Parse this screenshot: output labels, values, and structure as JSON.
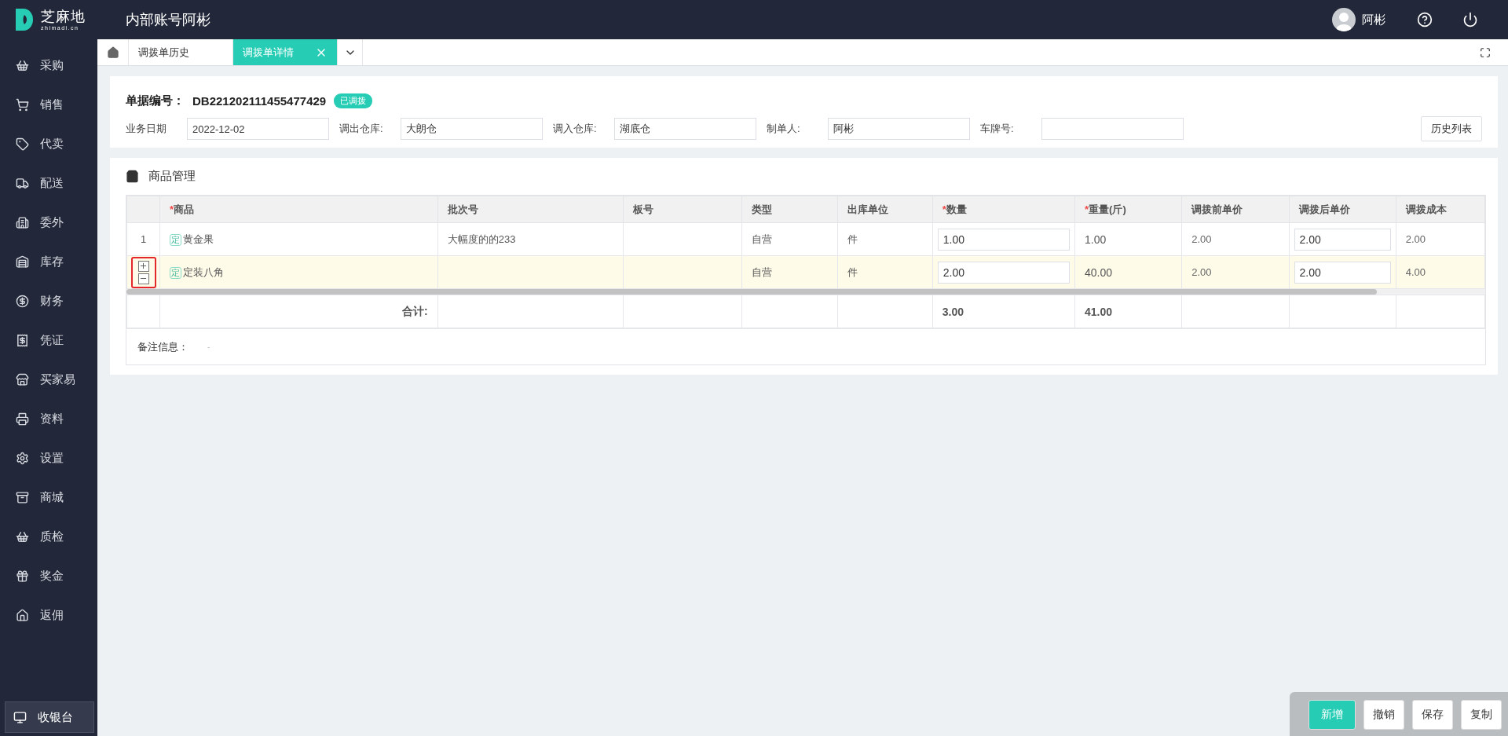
{
  "brand": {
    "name": "芝麻地",
    "domain": "zhimadi.cn"
  },
  "account": "内部账号阿彬",
  "user": {
    "name": "阿彬"
  },
  "sidebar": {
    "items": [
      {
        "label": "采购"
      },
      {
        "label": "销售"
      },
      {
        "label": "代卖"
      },
      {
        "label": "配送"
      },
      {
        "label": "委外"
      },
      {
        "label": "库存"
      },
      {
        "label": "财务"
      },
      {
        "label": "凭证"
      },
      {
        "label": "买家易"
      },
      {
        "label": "资料"
      },
      {
        "label": "设置"
      },
      {
        "label": "商城"
      },
      {
        "label": "质检"
      },
      {
        "label": "奖金"
      },
      {
        "label": "返佣"
      }
    ],
    "footer": {
      "label": "收银台"
    }
  },
  "tabs": [
    {
      "label": "调拨单历史",
      "selected": false,
      "closable": false
    },
    {
      "label": "调拨单详情",
      "selected": true,
      "closable": true
    }
  ],
  "order": {
    "number_label": "单据编号：",
    "number": "DB221202111455477429",
    "status": "已调拨",
    "fields": [
      {
        "label": "业务日期",
        "value": "2022-12-02"
      },
      {
        "label": "调出仓库:",
        "value": "大朗仓"
      },
      {
        "label": "调入仓库:",
        "value": "湖底仓"
      },
      {
        "label": "制单人:",
        "value": "阿彬"
      },
      {
        "label": "车牌号:"
      }
    ],
    "history_button": "历史列表"
  },
  "section": {
    "title": "商品管理"
  },
  "table": {
    "columns": [
      {
        "label": "商品",
        "marker": "*"
      },
      {
        "label": "批次号"
      },
      {
        "label": "板号"
      },
      {
        "label": "类型"
      },
      {
        "label": "出库单位"
      },
      {
        "label": "数量",
        "marker": "*"
      },
      {
        "label": "重量(斤)",
        "marker": "*"
      },
      {
        "label": "调拨前单价"
      },
      {
        "label": "调拨后单价"
      },
      {
        "label": "调拨成本"
      }
    ],
    "rows": [
      {
        "kind": "numbered",
        "index": "1",
        "selected": false,
        "tag": "定",
        "product": "黄金果",
        "batch": "大幅度的的233",
        "type": "自营",
        "unit": "件",
        "quantity": "1.00",
        "weight": "1.00",
        "price_before": "2.00",
        "price_after": "2.00",
        "cost": "2.00"
      },
      {
        "kind": "editing",
        "selected": true,
        "tag": "定",
        "product": "定装八角",
        "type": "自营",
        "unit": "件",
        "quantity": "2.00",
        "weight": "40.00",
        "price_before": "2.00",
        "price_after": "2.00",
        "cost": "4.00"
      }
    ],
    "total": {
      "label": "合计:",
      "quantity": "3.00",
      "weight": "41.00"
    },
    "remark": {
      "label": "备注信息：",
      "value": "-"
    }
  },
  "actions": [
    {
      "label": "新增",
      "primary": true
    },
    {
      "label": "撤销",
      "primary": false
    },
    {
      "label": "保存",
      "primary": false
    },
    {
      "label": "复制",
      "primary": false
    }
  ]
}
